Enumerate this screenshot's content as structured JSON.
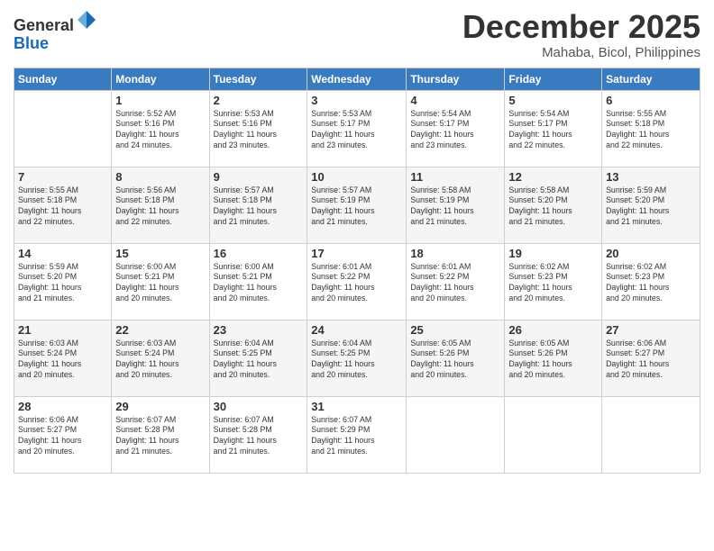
{
  "header": {
    "logo_line1": "General",
    "logo_line2": "Blue",
    "month": "December 2025",
    "location": "Mahaba, Bicol, Philippines"
  },
  "days_of_week": [
    "Sunday",
    "Monday",
    "Tuesday",
    "Wednesday",
    "Thursday",
    "Friday",
    "Saturday"
  ],
  "weeks": [
    [
      {
        "day": "",
        "info": ""
      },
      {
        "day": "1",
        "info": "Sunrise: 5:52 AM\nSunset: 5:16 PM\nDaylight: 11 hours\nand 24 minutes."
      },
      {
        "day": "2",
        "info": "Sunrise: 5:53 AM\nSunset: 5:16 PM\nDaylight: 11 hours\nand 23 minutes."
      },
      {
        "day": "3",
        "info": "Sunrise: 5:53 AM\nSunset: 5:17 PM\nDaylight: 11 hours\nand 23 minutes."
      },
      {
        "day": "4",
        "info": "Sunrise: 5:54 AM\nSunset: 5:17 PM\nDaylight: 11 hours\nand 23 minutes."
      },
      {
        "day": "5",
        "info": "Sunrise: 5:54 AM\nSunset: 5:17 PM\nDaylight: 11 hours\nand 22 minutes."
      },
      {
        "day": "6",
        "info": "Sunrise: 5:55 AM\nSunset: 5:18 PM\nDaylight: 11 hours\nand 22 minutes."
      }
    ],
    [
      {
        "day": "7",
        "info": "Sunrise: 5:55 AM\nSunset: 5:18 PM\nDaylight: 11 hours\nand 22 minutes."
      },
      {
        "day": "8",
        "info": "Sunrise: 5:56 AM\nSunset: 5:18 PM\nDaylight: 11 hours\nand 22 minutes."
      },
      {
        "day": "9",
        "info": "Sunrise: 5:57 AM\nSunset: 5:18 PM\nDaylight: 11 hours\nand 21 minutes."
      },
      {
        "day": "10",
        "info": "Sunrise: 5:57 AM\nSunset: 5:19 PM\nDaylight: 11 hours\nand 21 minutes."
      },
      {
        "day": "11",
        "info": "Sunrise: 5:58 AM\nSunset: 5:19 PM\nDaylight: 11 hours\nand 21 minutes."
      },
      {
        "day": "12",
        "info": "Sunrise: 5:58 AM\nSunset: 5:20 PM\nDaylight: 11 hours\nand 21 minutes."
      },
      {
        "day": "13",
        "info": "Sunrise: 5:59 AM\nSunset: 5:20 PM\nDaylight: 11 hours\nand 21 minutes."
      }
    ],
    [
      {
        "day": "14",
        "info": "Sunrise: 5:59 AM\nSunset: 5:20 PM\nDaylight: 11 hours\nand 21 minutes."
      },
      {
        "day": "15",
        "info": "Sunrise: 6:00 AM\nSunset: 5:21 PM\nDaylight: 11 hours\nand 20 minutes."
      },
      {
        "day": "16",
        "info": "Sunrise: 6:00 AM\nSunset: 5:21 PM\nDaylight: 11 hours\nand 20 minutes."
      },
      {
        "day": "17",
        "info": "Sunrise: 6:01 AM\nSunset: 5:22 PM\nDaylight: 11 hours\nand 20 minutes."
      },
      {
        "day": "18",
        "info": "Sunrise: 6:01 AM\nSunset: 5:22 PM\nDaylight: 11 hours\nand 20 minutes."
      },
      {
        "day": "19",
        "info": "Sunrise: 6:02 AM\nSunset: 5:23 PM\nDaylight: 11 hours\nand 20 minutes."
      },
      {
        "day": "20",
        "info": "Sunrise: 6:02 AM\nSunset: 5:23 PM\nDaylight: 11 hours\nand 20 minutes."
      }
    ],
    [
      {
        "day": "21",
        "info": "Sunrise: 6:03 AM\nSunset: 5:24 PM\nDaylight: 11 hours\nand 20 minutes."
      },
      {
        "day": "22",
        "info": "Sunrise: 6:03 AM\nSunset: 5:24 PM\nDaylight: 11 hours\nand 20 minutes."
      },
      {
        "day": "23",
        "info": "Sunrise: 6:04 AM\nSunset: 5:25 PM\nDaylight: 11 hours\nand 20 minutes."
      },
      {
        "day": "24",
        "info": "Sunrise: 6:04 AM\nSunset: 5:25 PM\nDaylight: 11 hours\nand 20 minutes."
      },
      {
        "day": "25",
        "info": "Sunrise: 6:05 AM\nSunset: 5:26 PM\nDaylight: 11 hours\nand 20 minutes."
      },
      {
        "day": "26",
        "info": "Sunrise: 6:05 AM\nSunset: 5:26 PM\nDaylight: 11 hours\nand 20 minutes."
      },
      {
        "day": "27",
        "info": "Sunrise: 6:06 AM\nSunset: 5:27 PM\nDaylight: 11 hours\nand 20 minutes."
      }
    ],
    [
      {
        "day": "28",
        "info": "Sunrise: 6:06 AM\nSunset: 5:27 PM\nDaylight: 11 hours\nand 20 minutes."
      },
      {
        "day": "29",
        "info": "Sunrise: 6:07 AM\nSunset: 5:28 PM\nDaylight: 11 hours\nand 21 minutes."
      },
      {
        "day": "30",
        "info": "Sunrise: 6:07 AM\nSunset: 5:28 PM\nDaylight: 11 hours\nand 21 minutes."
      },
      {
        "day": "31",
        "info": "Sunrise: 6:07 AM\nSunset: 5:29 PM\nDaylight: 11 hours\nand 21 minutes."
      },
      {
        "day": "",
        "info": ""
      },
      {
        "day": "",
        "info": ""
      },
      {
        "day": "",
        "info": ""
      }
    ]
  ]
}
